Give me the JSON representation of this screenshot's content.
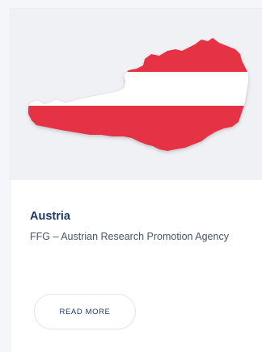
{
  "card": {
    "image_icon": "austria-flag-map",
    "title": "Austria",
    "subtitle": "FFG – Austrian Research Promotion Agency",
    "button_label": "READ MORE"
  },
  "colors": {
    "flag_red": "#e63244",
    "flag_white": "#ffffff",
    "title": "#1d3a66",
    "image_background": "#f0f1f5"
  }
}
